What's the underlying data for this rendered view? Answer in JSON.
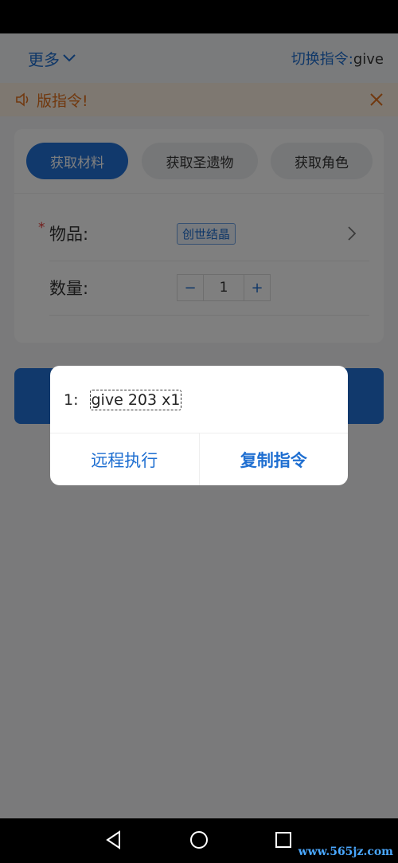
{
  "header": {
    "more_label": "更多",
    "switch_label": "切换指令:",
    "switch_value": "give"
  },
  "notice": {
    "text": "版指令!"
  },
  "tabs": [
    {
      "label": "获取材料"
    },
    {
      "label": "获取圣遗物"
    },
    {
      "label": "获取角色"
    }
  ],
  "form": {
    "item_label": "物品:",
    "item_required": "*",
    "item_value": "创世结晶",
    "qty_label": "数量:",
    "qty_minus": "−",
    "qty_value": "1",
    "qty_plus": "+"
  },
  "dialog": {
    "line_num": "1:",
    "command": "give 203 x1",
    "left_action": "远程执行",
    "right_action": "复制指令"
  },
  "watermark": "www.565jz.com",
  "colors": {
    "accent": "#2272d8",
    "notice": "#e2711d",
    "notice_bg": "#fdf1e2"
  }
}
